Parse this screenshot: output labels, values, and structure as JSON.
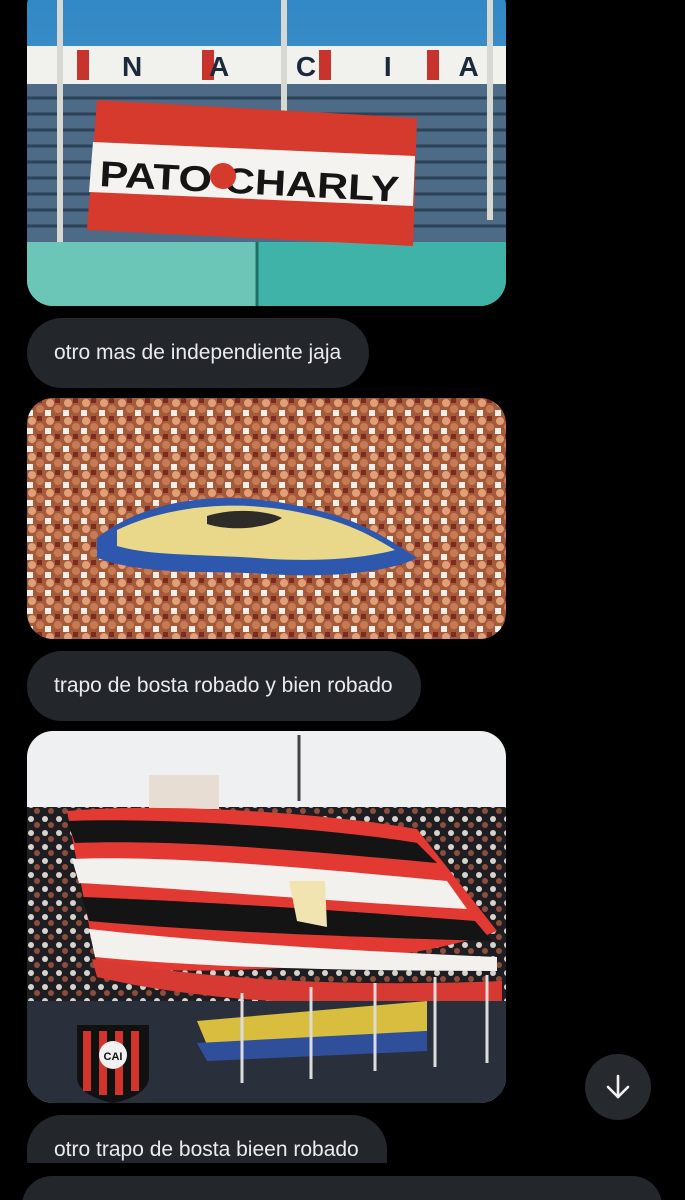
{
  "chat": {
    "messages": [
      {
        "type": "image",
        "image_name": "pato-charly-banner-photo"
      },
      {
        "type": "text",
        "text": "otro mas de independiente jaja"
      },
      {
        "type": "image",
        "image_name": "stolen-flag-crowd-photo"
      },
      {
        "type": "text",
        "text": "trapo de bosta robado y bien robado"
      },
      {
        "type": "image",
        "image_name": "striped-flag-stadium-photo"
      },
      {
        "type": "text",
        "text": "otro trapo de bosta bieen robado"
      }
    ],
    "banner_text": "PATO   CHARLY",
    "stadium_letters": "N A C I A I",
    "crest_letters": "CAI"
  },
  "scroll_button": {
    "icon": "arrow-down-icon"
  },
  "colors": {
    "background": "#000000",
    "bubble": "#23262b",
    "bubble_text": "#e9ebee",
    "fab": "#26292e"
  }
}
